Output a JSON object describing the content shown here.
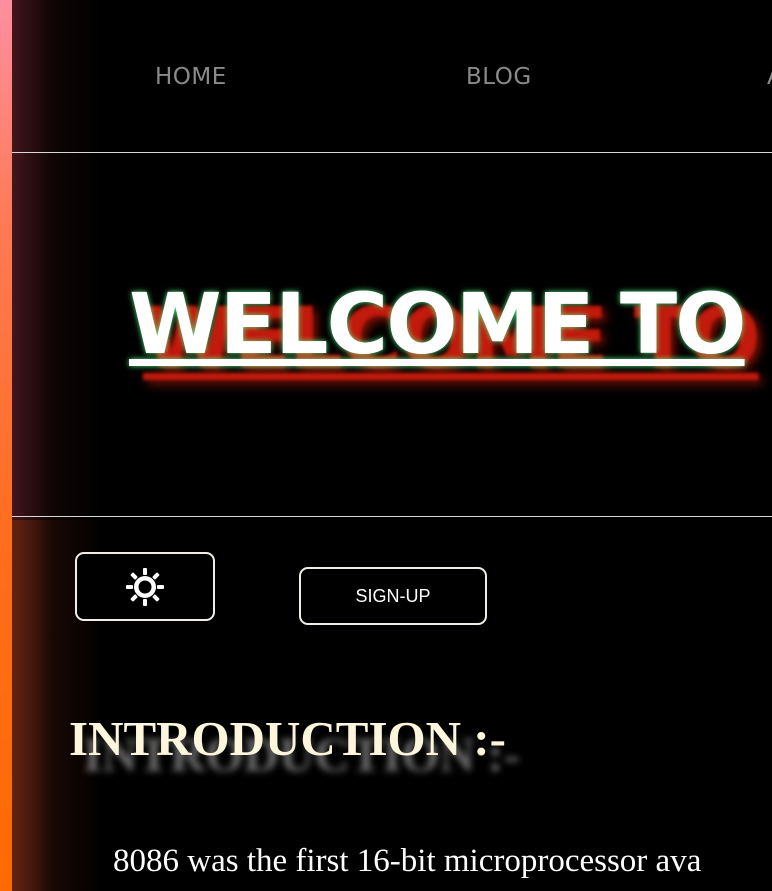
{
  "nav": {
    "links": [
      {
        "label": "HOME"
      },
      {
        "label": "BLOG"
      },
      {
        "label": "A"
      }
    ]
  },
  "hero": {
    "title": "WELCOME TO"
  },
  "controls": {
    "theme_icon": "sun-icon",
    "signup_label": "SIGN-UP"
  },
  "intro": {
    "heading": "INTRODUCTION :-",
    "line1": "8086 was the first 16-bit microprocessor ava",
    "line2": "     "
  },
  "colors": {
    "stripe_top": "#ff8fa0",
    "stripe_bottom": "#ff6a00",
    "title_glow": "#5aff8c",
    "title_shadow": "#c21a0c",
    "heading": "#fdf6dc"
  }
}
